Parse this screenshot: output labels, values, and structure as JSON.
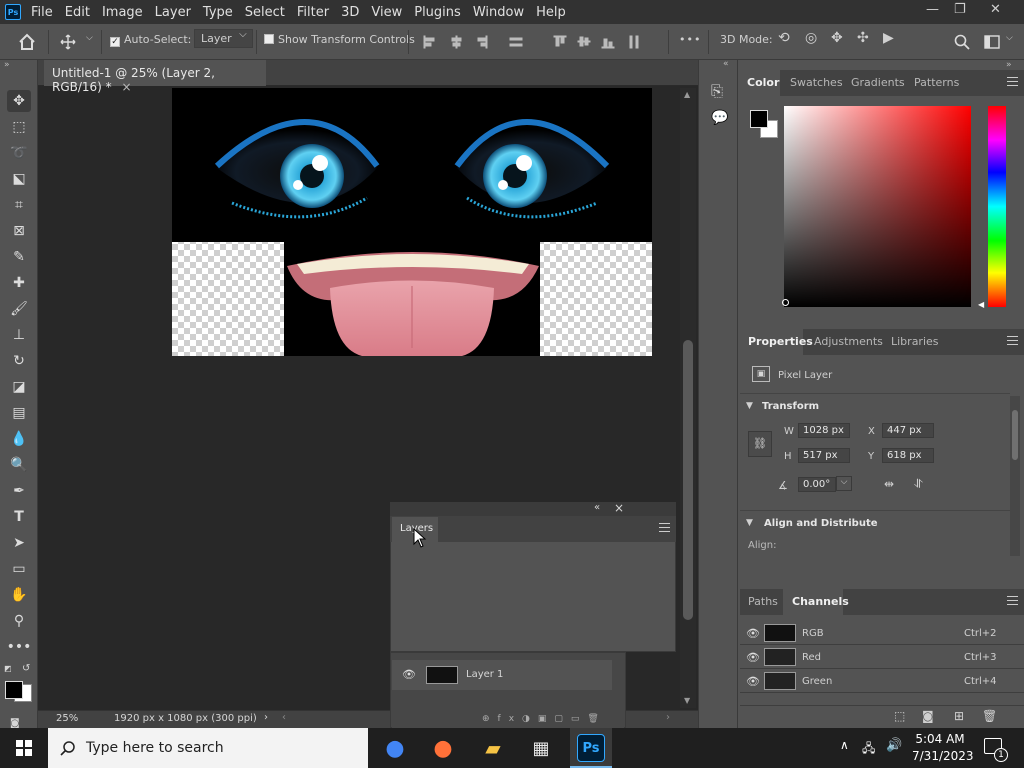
{
  "app": {
    "logo": "Ps"
  },
  "menu": [
    "File",
    "Edit",
    "Image",
    "Layer",
    "Type",
    "Select",
    "Filter",
    "3D",
    "View",
    "Plugins",
    "Window",
    "Help"
  ],
  "window_controls": [
    "—",
    "❐",
    "✕"
  ],
  "options": {
    "auto_select_label": "Auto-Select:",
    "auto_select_target": "Layer",
    "show_transform_label": "Show Transform Controls",
    "more": "•••",
    "mode_3d_label": "3D Mode:"
  },
  "document": {
    "tab_title": "Untitled-1 @ 25% (Layer 2, RGB/16) *",
    "close_glyph": "×",
    "zoom": "25%",
    "doc_info": "1920 px x 1080 px (300 ppi)"
  },
  "layers_panel": {
    "tab": "Layers",
    "collapse_glyph": "«",
    "close_glyph": "×",
    "rows": [
      {
        "name": "Layer 1"
      }
    ]
  },
  "color_panel": {
    "tabs": [
      "Color",
      "Swatches",
      "Gradients",
      "Patterns"
    ],
    "foreground": "#000000",
    "background": "#ffffff",
    "hue_color": "#ff0000"
  },
  "properties_panel": {
    "tabs": [
      "Properties",
      "Adjustments",
      "Libraries"
    ],
    "kind": "Pixel Layer",
    "transform_title": "Transform",
    "w_label": "W",
    "w": "1028 px",
    "h_label": "H",
    "h": "517 px",
    "x_label": "X",
    "x": "447 px",
    "y_label": "Y",
    "y": "618 px",
    "angle": "0.00°",
    "align_title": "Align and Distribute",
    "align_label": "Align:"
  },
  "channels_panel": {
    "tabs": [
      "Paths",
      "Channels"
    ],
    "rows": [
      {
        "name": "RGB",
        "shortcut": "Ctrl+2"
      },
      {
        "name": "Red",
        "shortcut": "Ctrl+3"
      },
      {
        "name": "Green",
        "shortcut": "Ctrl+4"
      }
    ]
  },
  "taskbar": {
    "search_placeholder": "Type here to search",
    "time": "5:04 AM",
    "date": "7/31/2023",
    "notification_count": "1",
    "apps": [
      {
        "name": "chrome",
        "glyph": "●",
        "color": "#4285f4"
      },
      {
        "name": "firefox",
        "glyph": "●",
        "color": "#ff7139"
      },
      {
        "name": "file-explorer",
        "glyph": "▰",
        "color": "#f6c344"
      },
      {
        "name": "store",
        "glyph": "▦",
        "color": "#e8e8e8"
      },
      {
        "name": "photoshop",
        "glyph": "Ps",
        "color": "#31a8ff"
      }
    ]
  }
}
